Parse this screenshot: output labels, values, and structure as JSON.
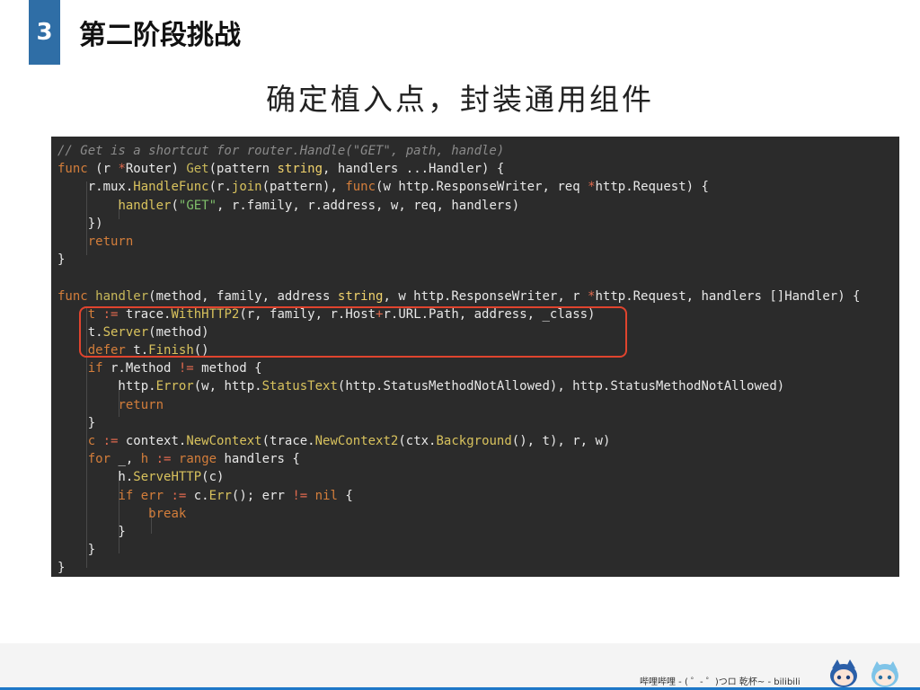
{
  "header": {
    "section_number": "3",
    "section_title": "第二阶段挑战"
  },
  "slide": {
    "subtitle": "确定植入点，封装通用组件"
  },
  "code": {
    "lines": [
      [
        {
          "t": "// Get is a shortcut for router.Handle(\"GET\", path, handle)",
          "c": "comment"
        }
      ],
      [
        {
          "t": "func",
          "c": "keyword"
        },
        {
          "t": " (r ",
          "c": "plain"
        },
        {
          "t": "*",
          "c": "op"
        },
        {
          "t": "Router) ",
          "c": "plain"
        },
        {
          "t": "Get",
          "c": "func"
        },
        {
          "t": "(pattern ",
          "c": "plain"
        },
        {
          "t": "string",
          "c": "type"
        },
        {
          "t": ", handlers ...Handler) {",
          "c": "plain"
        }
      ],
      [
        {
          "t": "    r.mux.",
          "c": "plain"
        },
        {
          "t": "HandleFunc",
          "c": "method"
        },
        {
          "t": "(r.",
          "c": "plain"
        },
        {
          "t": "join",
          "c": "method"
        },
        {
          "t": "(pattern), ",
          "c": "plain"
        },
        {
          "t": "func",
          "c": "keyword"
        },
        {
          "t": "(w http.ResponseWriter, req ",
          "c": "plain"
        },
        {
          "t": "*",
          "c": "op"
        },
        {
          "t": "http.Request) {",
          "c": "plain"
        }
      ],
      [
        {
          "t": "        ",
          "c": "plain"
        },
        {
          "t": "handler",
          "c": "method"
        },
        {
          "t": "(",
          "c": "plain"
        },
        {
          "t": "\"GET\"",
          "c": "string"
        },
        {
          "t": ", r.family, r.address, w, req, handlers)",
          "c": "plain"
        }
      ],
      [
        {
          "t": "    })",
          "c": "plain"
        }
      ],
      [
        {
          "t": "    ",
          "c": "plain"
        },
        {
          "t": "return",
          "c": "keyword"
        }
      ],
      [
        {
          "t": "}",
          "c": "plain"
        }
      ],
      [
        {
          "t": "",
          "c": "plain"
        }
      ],
      [
        {
          "t": "func",
          "c": "keyword"
        },
        {
          "t": " ",
          "c": "plain"
        },
        {
          "t": "handler",
          "c": "func"
        },
        {
          "t": "(method, family, address ",
          "c": "plain"
        },
        {
          "t": "string",
          "c": "type"
        },
        {
          "t": ", w http.ResponseWriter, r ",
          "c": "plain"
        },
        {
          "t": "*",
          "c": "op"
        },
        {
          "t": "http.Request, handlers []Handler) {",
          "c": "plain"
        }
      ],
      [
        {
          "t": "    ",
          "c": "plain"
        },
        {
          "t": "t",
          "c": "keyword"
        },
        {
          "t": " ",
          "c": "plain"
        },
        {
          "t": ":=",
          "c": "op"
        },
        {
          "t": " trace.",
          "c": "plain"
        },
        {
          "t": "WithHTTP2",
          "c": "method"
        },
        {
          "t": "(r, family, r.Host",
          "c": "plain"
        },
        {
          "t": "+",
          "c": "op"
        },
        {
          "t": "r.URL.Path, address, _class)",
          "c": "plain"
        }
      ],
      [
        {
          "t": "    t.",
          "c": "plain"
        },
        {
          "t": "Server",
          "c": "method"
        },
        {
          "t": "(method)",
          "c": "plain"
        }
      ],
      [
        {
          "t": "    ",
          "c": "plain"
        },
        {
          "t": "defer",
          "c": "keyword"
        },
        {
          "t": " t.",
          "c": "plain"
        },
        {
          "t": "Finish",
          "c": "method"
        },
        {
          "t": "()",
          "c": "plain"
        }
      ],
      [
        {
          "t": "    ",
          "c": "plain"
        },
        {
          "t": "if",
          "c": "keyword"
        },
        {
          "t": " r.Method ",
          "c": "plain"
        },
        {
          "t": "!=",
          "c": "op"
        },
        {
          "t": " method {",
          "c": "plain"
        }
      ],
      [
        {
          "t": "        http.",
          "c": "plain"
        },
        {
          "t": "Error",
          "c": "method"
        },
        {
          "t": "(w, http.",
          "c": "plain"
        },
        {
          "t": "StatusText",
          "c": "method"
        },
        {
          "t": "(http.StatusMethodNotAllowed), http.StatusMethodNotAllowed)",
          "c": "plain"
        }
      ],
      [
        {
          "t": "        ",
          "c": "plain"
        },
        {
          "t": "return",
          "c": "keyword"
        }
      ],
      [
        {
          "t": "    }",
          "c": "plain"
        }
      ],
      [
        {
          "t": "    ",
          "c": "plain"
        },
        {
          "t": "c",
          "c": "keyword"
        },
        {
          "t": " ",
          "c": "plain"
        },
        {
          "t": ":=",
          "c": "op"
        },
        {
          "t": " context.",
          "c": "plain"
        },
        {
          "t": "NewContext",
          "c": "method"
        },
        {
          "t": "(trace.",
          "c": "plain"
        },
        {
          "t": "NewContext2",
          "c": "method"
        },
        {
          "t": "(ctx.",
          "c": "plain"
        },
        {
          "t": "Background",
          "c": "method"
        },
        {
          "t": "(), t), r, w)",
          "c": "plain"
        }
      ],
      [
        {
          "t": "    ",
          "c": "plain"
        },
        {
          "t": "for",
          "c": "keyword"
        },
        {
          "t": " _, ",
          "c": "plain"
        },
        {
          "t": "h",
          "c": "keyword"
        },
        {
          "t": " ",
          "c": "plain"
        },
        {
          "t": ":=",
          "c": "op"
        },
        {
          "t": " ",
          "c": "plain"
        },
        {
          "t": "range",
          "c": "keyword"
        },
        {
          "t": " handlers {",
          "c": "plain"
        }
      ],
      [
        {
          "t": "        h.",
          "c": "plain"
        },
        {
          "t": "ServeHTTP",
          "c": "method"
        },
        {
          "t": "(c)",
          "c": "plain"
        }
      ],
      [
        {
          "t": "        ",
          "c": "plain"
        },
        {
          "t": "if",
          "c": "keyword"
        },
        {
          "t": " ",
          "c": "plain"
        },
        {
          "t": "err",
          "c": "keyword"
        },
        {
          "t": " ",
          "c": "plain"
        },
        {
          "t": ":=",
          "c": "op"
        },
        {
          "t": " c.",
          "c": "plain"
        },
        {
          "t": "Err",
          "c": "method"
        },
        {
          "t": "(); err ",
          "c": "plain"
        },
        {
          "t": "!=",
          "c": "op"
        },
        {
          "t": " ",
          "c": "plain"
        },
        {
          "t": "nil",
          "c": "keyword"
        },
        {
          "t": " {",
          "c": "plain"
        }
      ],
      [
        {
          "t": "            ",
          "c": "plain"
        },
        {
          "t": "break",
          "c": "keyword"
        }
      ],
      [
        {
          "t": "        }",
          "c": "plain"
        }
      ],
      [
        {
          "t": "    }",
          "c": "plain"
        }
      ],
      [
        {
          "t": "}",
          "c": "plain"
        }
      ]
    ]
  },
  "footer": {
    "credit": "哔哩哔哩 - ( ゜- ゜)つロ 乾杯~ - bilibili"
  },
  "colors": {
    "badge": "#2f6ea6",
    "code_background": "#2b2b2b",
    "highlight_border": "#e0442e",
    "footer_rule": "#1e78c8"
  }
}
